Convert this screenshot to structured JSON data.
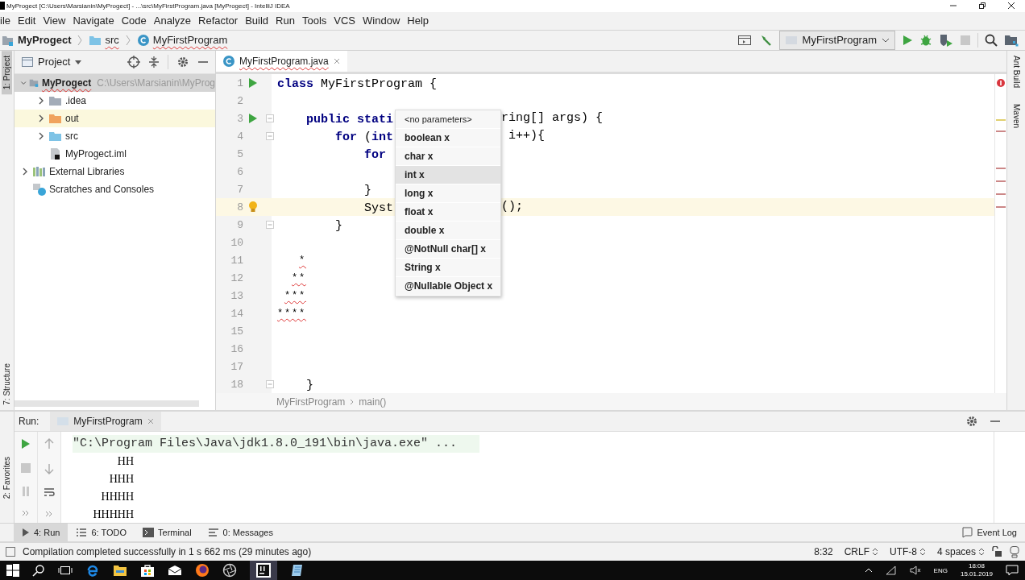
{
  "window": {
    "title": "MyProgect [C:\\Users\\Marsianin\\MyProgect] - ...\\src\\MyFirstProgram.java [MyProgect] - IntelliJ IDEA"
  },
  "menu": [
    "ile",
    "Edit",
    "View",
    "Navigate",
    "Code",
    "Analyze",
    "Refactor",
    "Build",
    "Run",
    "Tools",
    "VCS",
    "Window",
    "Help"
  ],
  "breadcrumb": [
    {
      "label": "MyProgect",
      "kind": "module"
    },
    {
      "label": "src",
      "kind": "folder"
    },
    {
      "label": "MyFirstProgram",
      "kind": "class"
    }
  ],
  "run_config": {
    "value": "MyFirstProgram"
  },
  "left_stripe": [
    {
      "label": "1: Project",
      "selected": true
    },
    {
      "label": "7: Structure",
      "selected": false
    },
    {
      "label": "2: Favorites",
      "selected": false
    }
  ],
  "right_stripe": [
    "Ant Build",
    "Maven"
  ],
  "project_panel": {
    "title": "Project"
  },
  "project_tree": [
    {
      "label": "MyProgect",
      "path": "C:\\Users\\Marsianin\\MyProg",
      "kind": "module",
      "expanded": true,
      "selected": true,
      "excluded": false,
      "children": [
        {
          "label": ".idea",
          "kind": "folder",
          "color": "#a3acb8",
          "expanded": false,
          "selected": false,
          "excluded": false
        },
        {
          "label": "out",
          "kind": "folder",
          "color": "#f0a35e",
          "expanded": false,
          "selected": false,
          "excluded": true
        },
        {
          "label": "src",
          "kind": "folder",
          "color": "#7ec3e6",
          "expanded": false,
          "selected": false,
          "excluded": false
        },
        {
          "label": "MyProgect.iml",
          "kind": "file",
          "selected": false,
          "excluded": false
        }
      ]
    },
    {
      "label": "External Libraries",
      "kind": "library",
      "expanded": false,
      "selected": false,
      "excluded": false
    },
    {
      "label": "Scratches and Consoles",
      "kind": "scratches",
      "selected": false,
      "excluded": false
    }
  ],
  "editor_tab": {
    "label": "MyFirstProgram.java"
  },
  "code_lines": [
    {
      "number": "1",
      "kind": "run",
      "fold": false,
      "current": false,
      "text": "**class** MyFirstProgram {"
    },
    {
      "number": "2",
      "kind": "plain",
      "fold": false,
      "current": false
    },
    {
      "number": "3",
      "kind": "run",
      "fold": true,
      "current": false,
      "text": "    **public** **stati**",
      "right": "ring[] args) {"
    },
    {
      "number": "4",
      "kind": "plain",
      "fold": true,
      "current": false,
      "text": "        **for** (**int**",
      "right": " i++){"
    },
    {
      "number": "5",
      "kind": "plain",
      "fold": false,
      "current": false,
      "text": "            **for**"
    },
    {
      "number": "6",
      "kind": "plain",
      "fold": false,
      "current": false
    },
    {
      "number": "7",
      "kind": "plain",
      "fold": false,
      "current": false,
      "text": "            }"
    },
    {
      "number": "8",
      "kind": "bulb",
      "fold": false,
      "current": true,
      "text": "            Syst",
      "right": "();"
    },
    {
      "number": "9",
      "kind": "plain",
      "fold": true,
      "current": false,
      "text": "        }"
    },
    {
      "number": "10",
      "kind": "plain",
      "fold": false,
      "current": false
    },
    {
      "number": "11",
      "kind": "error",
      "fold": false,
      "current": false,
      "text": "*"
    },
    {
      "number": "12",
      "kind": "error",
      "fold": false,
      "current": false,
      "text": "**"
    },
    {
      "number": "13",
      "kind": "error",
      "fold": false,
      "current": false,
      "text": "***"
    },
    {
      "number": "14",
      "kind": "error",
      "fold": false,
      "current": false,
      "text": "****"
    },
    {
      "number": "15",
      "kind": "plain",
      "fold": false,
      "current": false
    },
    {
      "number": "16",
      "kind": "plain",
      "fold": false,
      "current": false
    },
    {
      "number": "17",
      "kind": "plain",
      "fold": false,
      "current": false
    },
    {
      "number": "18",
      "kind": "plain",
      "fold": true,
      "current": false,
      "text": "    }"
    }
  ],
  "param_popup": [
    {
      "label": "<no parameters>",
      "kind": "hint",
      "selected": false
    },
    {
      "label": "boolean x",
      "kind": "param",
      "selected": false
    },
    {
      "label": "char x",
      "kind": "param",
      "selected": false
    },
    {
      "label": "int x",
      "kind": "param",
      "selected": true
    },
    {
      "label": "long x",
      "kind": "param",
      "selected": false
    },
    {
      "label": "float x",
      "kind": "param",
      "selected": false
    },
    {
      "label": "double x",
      "kind": "param",
      "selected": false
    },
    {
      "label": "@NotNull char[] x",
      "kind": "param",
      "selected": false
    },
    {
      "label": "String x",
      "kind": "param",
      "selected": false
    },
    {
      "label": "@Nullable Object x",
      "kind": "param",
      "selected": false
    }
  ],
  "editor_breadcrumb": [
    "MyFirstProgram",
    "main()"
  ],
  "run_panel": {
    "title": "Run:",
    "tab": "MyFirstProgram",
    "console": [
      {
        "text": "\"C:\\Program Files\\Java\\jdk1.8.0_191\\bin\\java.exe\" ...",
        "kind": "command"
      },
      {
        "text": "HH",
        "kind": "output"
      },
      {
        "text": "HHH",
        "kind": "output"
      },
      {
        "text": "HHHH",
        "kind": "output"
      },
      {
        "text": "HHHHH",
        "kind": "output"
      }
    ]
  },
  "tool_tabs": [
    {
      "label": "4: Run",
      "kind": "run",
      "selected": true
    },
    {
      "label": "6: TODO",
      "kind": "list",
      "selected": false
    },
    {
      "label": "Terminal",
      "kind": "terminal",
      "selected": false
    },
    {
      "label": "0: Messages",
      "kind": "messages",
      "selected": false
    }
  ],
  "event_log": "Event Log",
  "status_bar": {
    "message": "Compilation completed successfully in 1 s 662 ms (29 minutes ago)",
    "position": "8:32",
    "line_separator": "CRLF",
    "encoding": "UTF-8",
    "indent": "4 spaces"
  },
  "taskbar": {
    "language": "ENG",
    "time": "18:08",
    "date": "15.01.2019"
  }
}
